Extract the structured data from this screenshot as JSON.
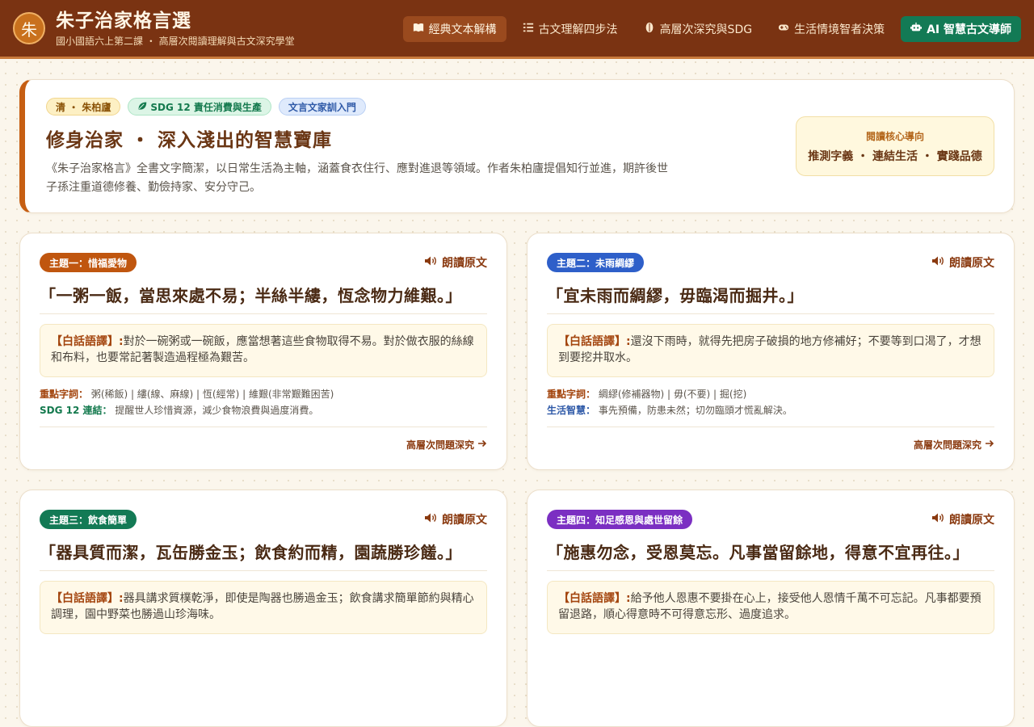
{
  "header": {
    "logo_char": "朱",
    "title": "朱子治家格言選",
    "subtitle": "國小國語六上第二課 ・ 高層次閱讀理解與古文深究學堂",
    "nav": [
      {
        "label": "經典文本解構",
        "icon": "book-icon"
      },
      {
        "label": "古文理解四步法",
        "icon": "list-icon"
      },
      {
        "label": "高層次深究與SDG",
        "icon": "seed-icon"
      },
      {
        "label": "生活情境智者決策",
        "icon": "gamepad-icon"
      },
      {
        "label": "AI 智慧古文導師",
        "icon": "robot-icon"
      }
    ]
  },
  "intro": {
    "chip_author": "清 ・ 朱柏廬",
    "chip_sdg": "SDG 12 責任消費與生產",
    "chip_tag": "文言文家訓入門",
    "title": "修身治家 ・ 深入淺出的智慧寶庫",
    "description": "《朱子治家格言》全書文字簡潔，以日常生活為主軸，涵蓋食衣住行、應對進退等領域。作者朱柏廬提倡知行並進，期許後世子孫注重道德修養、勤儉持家、安分守己。",
    "core_label": "閱讀核心導向",
    "core_value": "推測字義 ・ 連結生活 ・ 實踐品德"
  },
  "common": {
    "read_label": "朗讀原文",
    "trans_label": "【白話語譯】:",
    "deep_label": "高層次問題深究"
  },
  "cards": [
    {
      "badge": "主題一：惜福愛物",
      "badge_color": "#c0560f",
      "quote": "「一粥一飯，當思來處不易；半絲半縷，恆念物力維艱。」",
      "translation": "對於一碗粥或一碗飯，應當想著這些食物取得不易。對於做衣服的絲線和布料，也要常記著製造過程極為艱苦。",
      "meta1_label": "重點字詞：",
      "meta1_text": "粥(稀飯) | 縷(線、麻線) | 恆(經常) | 維艱(非常艱難困苦)",
      "meta2_label": "SDG 12 連結：",
      "meta2_text": "提醒世人珍惜資源，減少食物浪費與過度消費。"
    },
    {
      "badge": "主題二：未雨綢繆",
      "badge_color": "#2e5fc9",
      "quote": "「宜未雨而綢繆，毋臨渴而掘井。」",
      "translation": "還沒下雨時，就得先把房子破損的地方修補好；不要等到口渴了，才想到要挖井取水。",
      "meta1_label": "重點字詞：",
      "meta1_text": "綢繆(修補器物) | 毋(不要) | 掘(挖)",
      "meta2_label": "生活智慧：",
      "meta2_text": "事先預備，防患未然；切勿臨頭才慌亂解決。"
    },
    {
      "badge": "主題三：飲食簡單",
      "badge_color": "#137a55",
      "quote": "「器具質而潔，瓦缶勝金玉；飲食約而精，園蔬勝珍饈。」",
      "translation": "器具講求質樸乾淨，即使是陶器也勝過金玉；飲食講求簡單節約與精心調理，園中野菜也勝過山珍海味。",
      "meta1_label": "",
      "meta1_text": "",
      "meta2_label": "",
      "meta2_text": ""
    },
    {
      "badge": "主題四：知足感恩與處世留餘",
      "badge_color": "#7b2fc2",
      "quote": "「施惠勿念，受恩莫忘。凡事當留餘地，得意不宜再往。」",
      "translation": "給予他人恩惠不要掛在心上，接受他人恩情千萬不可忘記。凡事都要預留退路，順心得意時不可得意忘形、過度追求。",
      "meta1_label": "",
      "meta1_text": "",
      "meta2_label": "",
      "meta2_text": ""
    }
  ]
}
